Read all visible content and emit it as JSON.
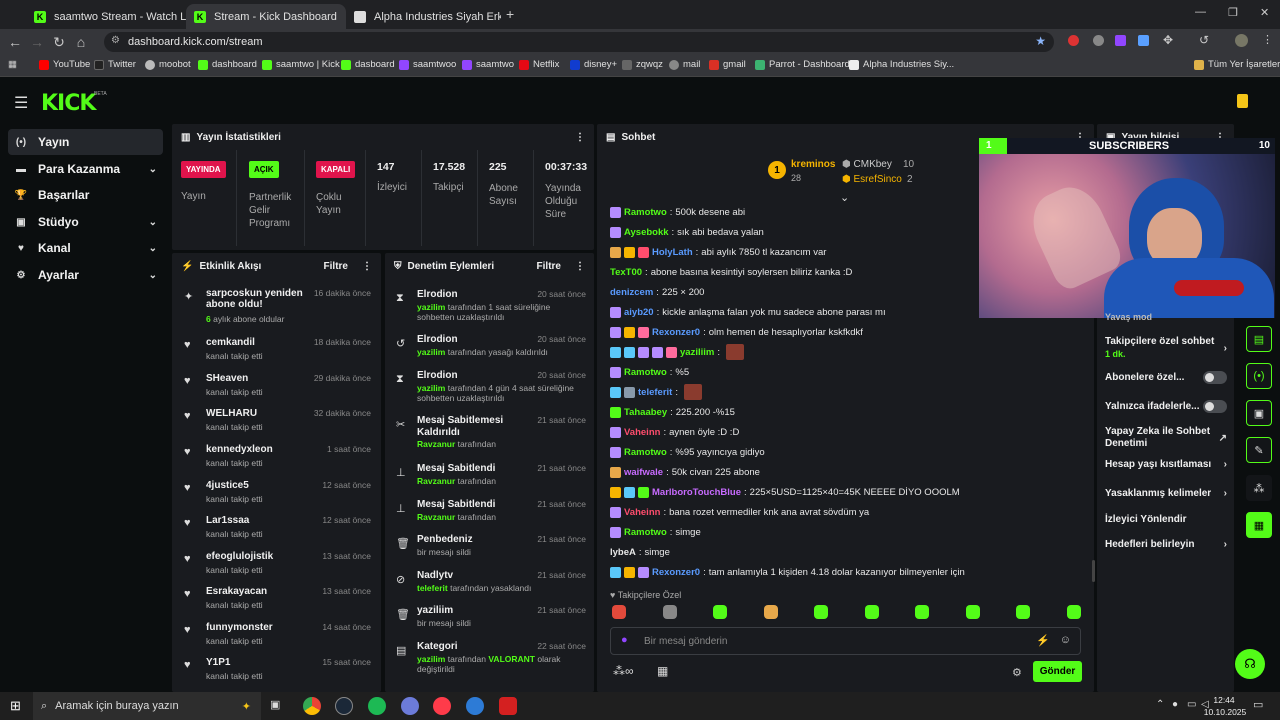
{
  "browser": {
    "tabs": [
      {
        "title": "saamtwo Stream - Watch Live o",
        "close": "✕"
      },
      {
        "title": "Stream - Kick Dashboard",
        "close": "✕"
      },
      {
        "title": "Alpha Industries Siyah Erkek S",
        "close": "✕"
      }
    ],
    "new_tab": "+",
    "url": "dashboard.kick.com/stream",
    "bookmarks": [
      "YouTube",
      "Twitter",
      "moobot",
      "dashboard",
      "saamtwo | Kick",
      "dasboard",
      "saamtwoo",
      "saamtwo",
      "Netflix",
      "disney+",
      "zqwqz",
      "mail",
      "gmail",
      "Parrot - Dashboard",
      "Alpha Industries Siy...",
      "Tüm Yer İşaretleri"
    ]
  },
  "kick": {
    "logo": "KICK",
    "beta": "BETA"
  },
  "sidebar": {
    "items": [
      {
        "label": "Yayın",
        "icon": "(•)"
      },
      {
        "label": "Para Kazanma",
        "icon": "▬"
      },
      {
        "label": "Başarılar",
        "icon": "🏆"
      },
      {
        "label": "Stüdyo",
        "icon": "▣"
      },
      {
        "label": "Kanal",
        "icon": "♥"
      },
      {
        "label": "Ayarlar",
        "icon": "⚙"
      }
    ]
  },
  "stats": {
    "title": "Yayın İstatistikleri",
    "live_badge": "YAYINDA",
    "live_label": "Yayın",
    "partner_badge": "AÇIK",
    "partner_label": "Partnerlik Gelir Programı",
    "multi_badge": "KAPALI",
    "multi_label": "Çoklu Yayın",
    "viewers": "147",
    "viewers_label": "İzleyici",
    "followers": "17.528",
    "followers_label": "Takipçi",
    "subs": "225",
    "subs_label": "Abone Sayısı",
    "duration": "00:37:33",
    "duration_label": "Yayında Olduğu Süre"
  },
  "activity": {
    "title": "Etkinlik Akışı",
    "filter": "Filtre",
    "items": [
      {
        "name": "sarpcoskun yeniden abone oldu!",
        "sub_num": "6",
        "sub": "aylık abone oldular",
        "time": "16 dakika önce"
      },
      {
        "name": "cemkandil",
        "sub": "kanalı takip etti",
        "time": "18 dakika önce"
      },
      {
        "name": "SHeaven",
        "sub": "kanalı takip etti",
        "time": "29 dakika önce"
      },
      {
        "name": "WELHARU",
        "sub": "kanalı takip etti",
        "time": "32 dakika önce"
      },
      {
        "name": "kennedyxleon",
        "sub": "kanalı takip etti",
        "time": "1 saat önce"
      },
      {
        "name": "4justice5",
        "sub": "kanalı takip etti",
        "time": "12 saat önce"
      },
      {
        "name": "Lar1ssaa",
        "sub": "kanalı takip etti",
        "time": "12 saat önce"
      },
      {
        "name": "efeoglulojistik",
        "sub": "kanalı takip etti",
        "time": "13 saat önce"
      },
      {
        "name": "Esrakayacan",
        "sub": "kanalı takip etti",
        "time": "13 saat önce"
      },
      {
        "name": "funnymonster",
        "sub": "kanalı takip etti",
        "time": "14 saat önce"
      },
      {
        "name": "Y1P1",
        "sub": "kanalı takip etti",
        "time": "15 saat önce"
      }
    ]
  },
  "moderation": {
    "title": "Denetim Eylemleri",
    "filter": "Filtre",
    "items": [
      {
        "icon": "⧗",
        "name": "Elrodion",
        "actor": "yazilim",
        "text": "tarafından 1 saat süreliğine sohbetten uzaklaştırıldı",
        "time": "20 saat önce"
      },
      {
        "icon": "↺",
        "name": "Elrodion",
        "actor": "yazilim",
        "text": "tarafından yasağı kaldırıldı",
        "time": "20 saat önce"
      },
      {
        "icon": "⧗",
        "name": "Elrodion",
        "actor": "yazilim",
        "text": "tarafından 4 gün 4 saat süreliğine sohbetten uzaklaştırıldı",
        "time": "20 saat önce"
      },
      {
        "icon": "✂",
        "name": "Mesaj Sabitlemesi Kaldırıldı",
        "actor": "Ravzanur",
        "text": "tarafından",
        "time": "21 saat önce"
      },
      {
        "icon": "⊥",
        "name": "Mesaj Sabitlendi",
        "actor": "Ravzanur",
        "text": "tarafından",
        "time": "21 saat önce"
      },
      {
        "icon": "⊥",
        "name": "Mesaj Sabitlendi",
        "actor": "Ravzanur",
        "text": "tarafından",
        "time": "21 saat önce"
      },
      {
        "icon": "🗑",
        "name": "Penbedeniz",
        "actor": "",
        "text": "bir mesajı sildi",
        "time": "21 saat önce"
      },
      {
        "icon": "⊘",
        "name": "Nadlytv",
        "actor": "teleferit",
        "text": "tarafından yasaklandı",
        "time": "21 saat önce"
      },
      {
        "icon": "🗑",
        "name": "yaziliim",
        "actor": "",
        "text": "bir mesajı sildi",
        "time": "21 saat önce"
      },
      {
        "icon": "▤",
        "name": "Kategori",
        "actor": "yazilim",
        "text": "tarafından",
        "extra": "VALORANT",
        "text2": "olarak değiştirildi",
        "time": "22 saat önce"
      }
    ]
  },
  "chat": {
    "title": "Sohbet",
    "top1": {
      "name": "kreminos",
      "count": "28",
      "rank": "1"
    },
    "top2": {
      "name": "CMKbey",
      "count": "10"
    },
    "top3": {
      "name": "EsrefSinco",
      "count": "2"
    },
    "messages": [
      {
        "user": "Ramotwo",
        "color": "#53fc18",
        "text": "500k desene abi"
      },
      {
        "user": "Aysebokk",
        "color": "#53fc18",
        "text": "sık abi bedava yalan"
      },
      {
        "user": "HolyLath",
        "color": "#5a9bff",
        "text": "abi aylık 7850 tl kazancım var"
      },
      {
        "user": "TexT00",
        "color": "#53fc18",
        "text": "abone basına kesintiyi soylersen biliriz kanka :D"
      },
      {
        "user": "denizcem",
        "color": "#5a9bff",
        "text": "225 × 200"
      },
      {
        "user": "aiyb20",
        "color": "#5a9bff",
        "text": "kickle anlaşma falan yok mu sadece abone parası mı"
      },
      {
        "user": "Rexonzer0",
        "color": "#5a9bff",
        "text": "olm hemen de hesaplıyorlar kskfkdkf"
      },
      {
        "user": "yaziliim",
        "color": "#53fc18",
        "text": ""
      },
      {
        "user": "Ramotwo",
        "color": "#53fc18",
        "text": "%5"
      },
      {
        "user": "teleferit",
        "color": "#5a9bff",
        "text": ""
      },
      {
        "user": "Tahaabey",
        "color": "#53fc18",
        "text": "225.200 -%15"
      },
      {
        "user": "Vaheinn",
        "color": "#ff4d6d",
        "text": "aynen öyle :D :D"
      },
      {
        "user": "Ramotwo",
        "color": "#53fc18",
        "text": "%95 yayıncıya gidiyo"
      },
      {
        "user": "waifwale",
        "color": "#c86bff",
        "text": "50k civarı 225 abone"
      },
      {
        "user": "MarlboroTouchBlue",
        "color": "#c86bff",
        "text": "225×5USD=1125×40=45K NEEEE DİYO OOOLM"
      },
      {
        "user": "Vaheinn",
        "color": "#ff4d6d",
        "text": "bana rozet vermediler knk ana avrat sövdüm ya"
      },
      {
        "user": "Ramotwo",
        "color": "#53fc18",
        "text": "simge"
      },
      {
        "user": "lybeA",
        "color": "#e8e8e8",
        "text": "simge"
      },
      {
        "user": "Rexonzer0",
        "color": "#5a9bff",
        "text": "tam anlamıyla 1 kişiden 4.18 dolar kazanıyor bilmeyenler için"
      }
    ],
    "followers_only": "Takipçilere Özel",
    "placeholder": "Bir mesaj gönderin",
    "send": "Gönder"
  },
  "info": {
    "title": "Yayın bilgisi",
    "subs_overlay": "SUBSCRIBERS",
    "subs_bar_left": "1",
    "subs_bar_right": "10",
    "partial": "Yavaş mod",
    "followers_chat": "Takipçilere özel sohbet",
    "followers_chat_val": "1 dk.",
    "subs_only": "Abonelere özel...",
    "emotes_only": "Yalnızca ifadelerle...",
    "ai_mod": "Yapay Zeka ile Sohbet Denetimi",
    "account_age": "Hesap yaşı kısıtlaması",
    "banned_words": "Yasaklanmış kelimeler",
    "viewer_redirect": "İzleyici Yönlendir",
    "goals": "Hedefleri belirleyin"
  },
  "taskbar": {
    "search": "Aramak için buraya yazın",
    "time": "12:44",
    "date": "10.10.2025"
  }
}
